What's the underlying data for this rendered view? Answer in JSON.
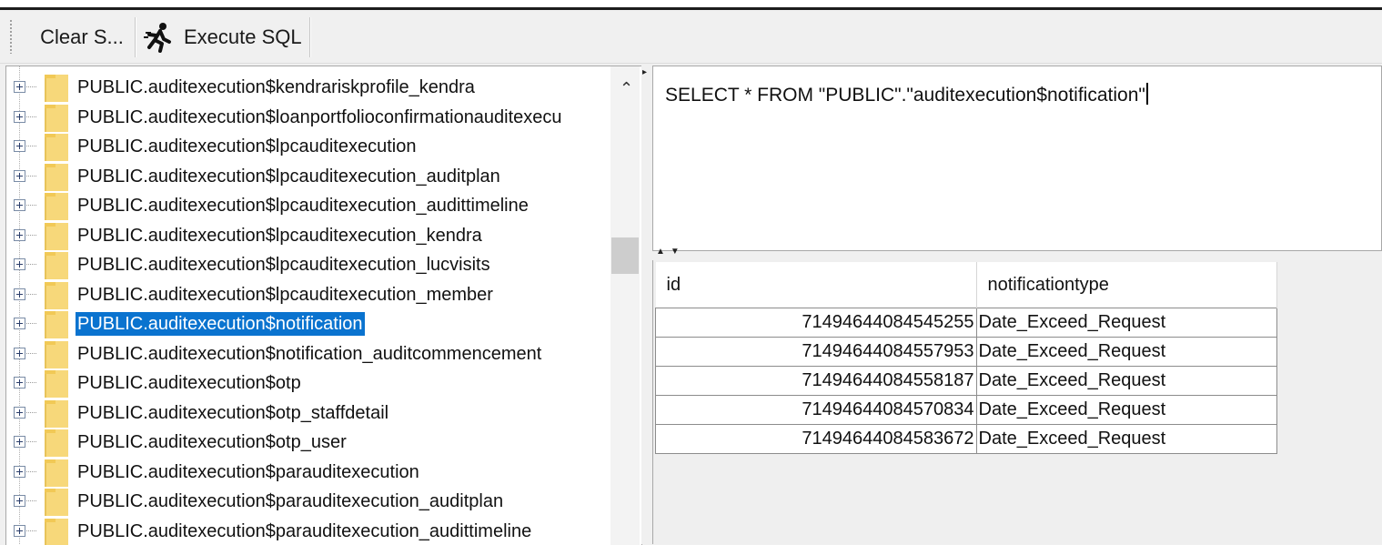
{
  "toolbar": {
    "clear_label": "Clear S...",
    "execute_label": "Execute SQL",
    "execute_icon": "running-man-icon"
  },
  "tree": {
    "items": [
      {
        "label": "PUBLIC.auditexecution$kendrariskprofile_kendra",
        "selected": false
      },
      {
        "label": "PUBLIC.auditexecution$loanportfolioconfirmationauditexecu",
        "selected": false
      },
      {
        "label": "PUBLIC.auditexecution$lpcauditexecution",
        "selected": false
      },
      {
        "label": "PUBLIC.auditexecution$lpcauditexecution_auditplan",
        "selected": false
      },
      {
        "label": "PUBLIC.auditexecution$lpcauditexecution_audittimeline",
        "selected": false
      },
      {
        "label": "PUBLIC.auditexecution$lpcauditexecution_kendra",
        "selected": false
      },
      {
        "label": "PUBLIC.auditexecution$lpcauditexecution_lucvisits",
        "selected": false
      },
      {
        "label": "PUBLIC.auditexecution$lpcauditexecution_member",
        "selected": false
      },
      {
        "label": "PUBLIC.auditexecution$notification",
        "selected": true
      },
      {
        "label": "PUBLIC.auditexecution$notification_auditcommencement",
        "selected": false
      },
      {
        "label": "PUBLIC.auditexecution$otp",
        "selected": false
      },
      {
        "label": "PUBLIC.auditexecution$otp_staffdetail",
        "selected": false
      },
      {
        "label": "PUBLIC.auditexecution$otp_user",
        "selected": false
      },
      {
        "label": "PUBLIC.auditexecution$parauditexecution",
        "selected": false
      },
      {
        "label": "PUBLIC.auditexecution$parauditexecution_auditplan",
        "selected": false
      },
      {
        "label": "PUBLIC.auditexecution$parauditexecution_audittimeline",
        "selected": false
      }
    ]
  },
  "editor": {
    "sql": "SELECT * FROM \"PUBLIC\".\"auditexecution$notification\""
  },
  "results": {
    "columns": [
      "id",
      "notificationtype"
    ],
    "rows": [
      [
        "71494644084545255",
        "Date_Exceed_Request"
      ],
      [
        "71494644084557953",
        "Date_Exceed_Request"
      ],
      [
        "71494644084558187",
        "Date_Exceed_Request"
      ],
      [
        "71494644084570834",
        "Date_Exceed_Request"
      ],
      [
        "71494644084583672",
        "Date_Exceed_Request"
      ]
    ]
  }
}
